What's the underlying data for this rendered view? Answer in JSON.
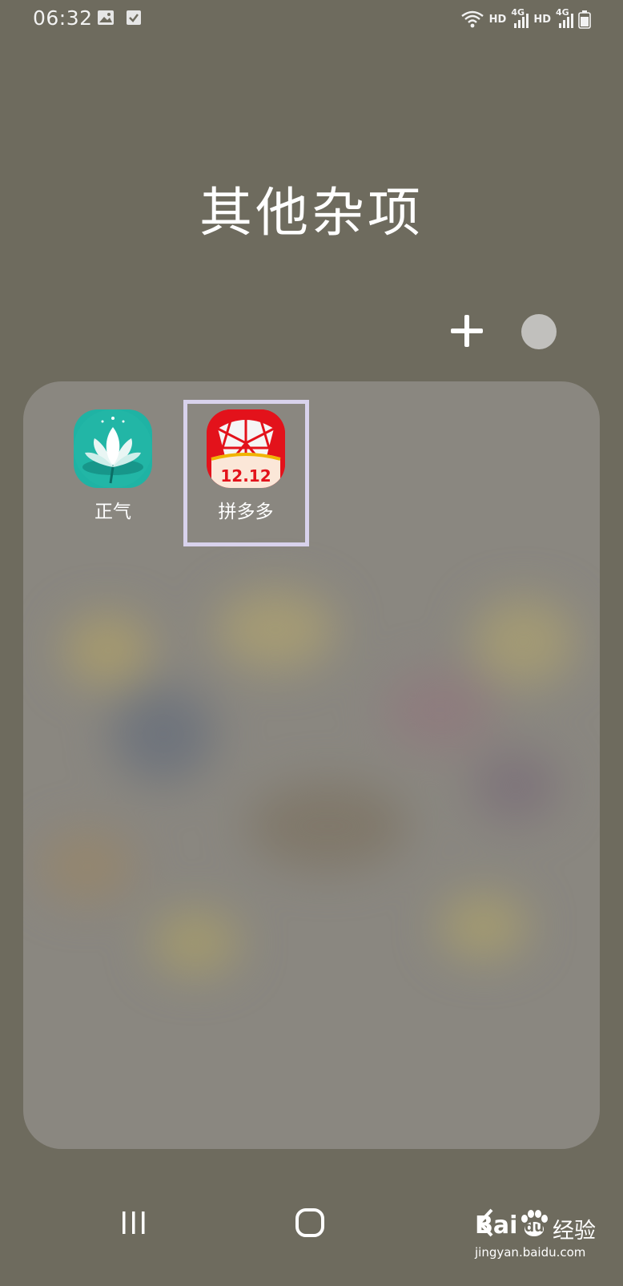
{
  "status_bar": {
    "time": "06:32",
    "icons": [
      "image-icon",
      "checkbox-icon",
      "wifi-icon",
      "signal-icon",
      "battery-icon"
    ],
    "network_labels": [
      "HD",
      "4G",
      "HD",
      "4G"
    ]
  },
  "folder": {
    "title": "其他杂项",
    "apps": [
      {
        "label": "正气",
        "icon": "lotus-icon"
      },
      {
        "label": "拼多多",
        "icon": "pinduoduo-icon",
        "badge": "12.12"
      }
    ]
  },
  "navigation": {
    "buttons": [
      "recents-icon",
      "home-icon",
      "back-icon"
    ]
  },
  "watermark": {
    "brand_latin": "Bai",
    "brand_du": "du",
    "brand_cn": "经验",
    "url": "jingyan.baidu.com"
  },
  "colors": {
    "background": "#6e6b5e",
    "folder_panel": "#8a8780",
    "highlight": "#d8d2ec",
    "zhengqi_teal": "#1fb3a4",
    "pdd_red": "#e3121b"
  }
}
